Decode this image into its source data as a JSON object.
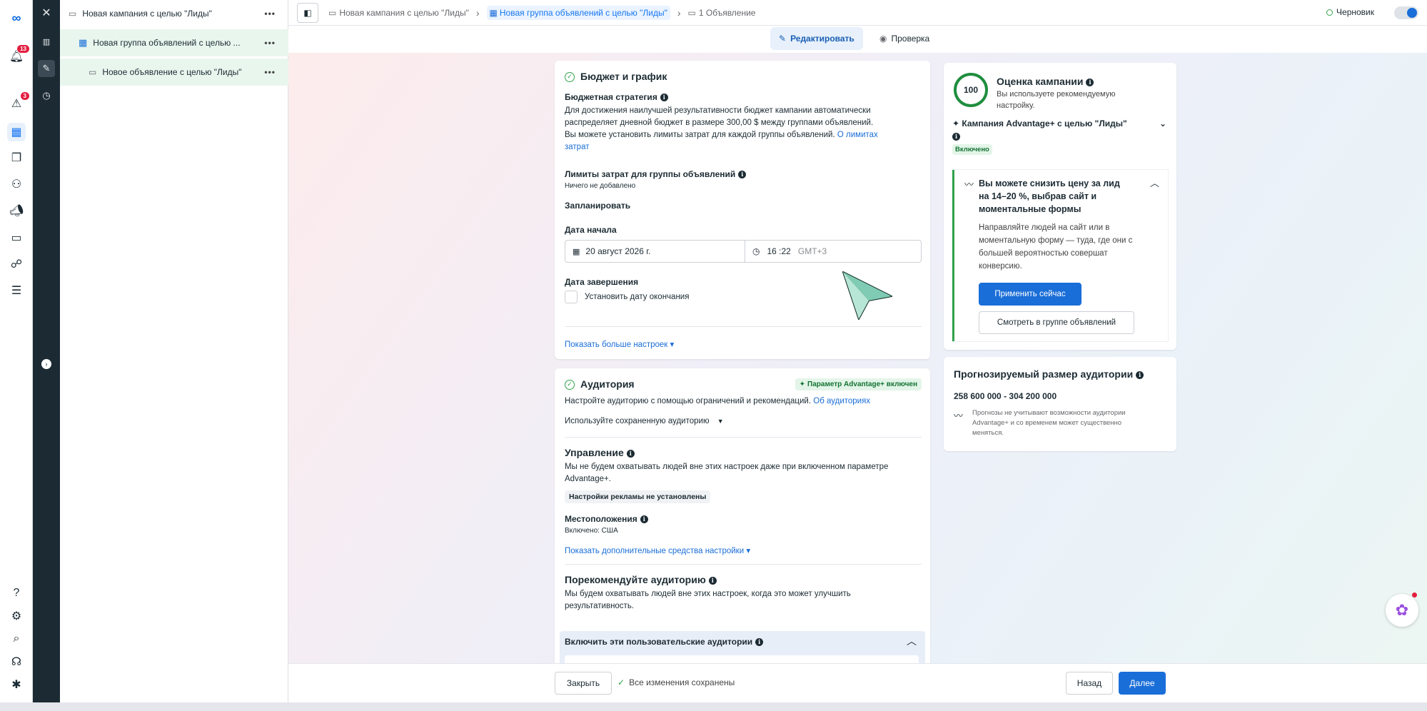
{
  "tree": {
    "campaign": "Новая кампания с целью \"Лиды\"",
    "adset": "Новая группа объявлений с целью ...",
    "ad": "Новое объявление с целью \"Лиды\""
  },
  "nav": {
    "notifications_badge": "13",
    "alerts_badge": "3"
  },
  "breadcrumb": {
    "campaign": "Новая кампания с целью \"Лиды\"",
    "adset": "Новая группа объявлений с целью \"Лиды\"",
    "ads": "1 Объявление"
  },
  "status": {
    "draft_label": "Черновик"
  },
  "tabs": {
    "edit": "Редактировать",
    "review": "Проверка"
  },
  "budget": {
    "title": "Бюджет и график",
    "strategy_label": "Бюджетная стратегия",
    "strategy_text_1": "Для достижения наилучшей результативности бюджет кампании автоматически",
    "strategy_text_2": "распределяет дневной бюджет в размере 300,00 $ между группами объявлений.",
    "strategy_text_3": "Вы можете установить лимиты затрат для каждой группы объявлений.",
    "strategy_link_1": "О лимитах",
    "strategy_link_2": "затрат",
    "limits_label": "Лимиты затрат для группы объявлений",
    "limits_value": "Ничего не добавлено",
    "schedule_label": "Запланировать",
    "start_label": "Дата начала",
    "start_date": "20 август 2026 г.",
    "start_time": "16 :22",
    "timezone": "GMT+3",
    "end_label": "Дата завершения",
    "end_checkbox": "Установить дату окончания",
    "more_settings": "Показать больше настроек ▾"
  },
  "audience": {
    "title": "Аудитория",
    "advantage_badge": "Параметр Advantage+ включен",
    "intro": "Настройте аудиторию с помощью ограничений и рекомендаций.",
    "intro_link": "Об аудиториях",
    "saved_dropdown": "Используйте сохраненную аудиторию",
    "control_title": "Управление",
    "control_text_1": "Мы не будем охватывать людей вне этих настроек даже при включенном параметре",
    "control_text_2": "Advantage+.",
    "no_settings_pill": "Настройки рекламы не установлены",
    "locations_label": "Местоположения",
    "locations_value": "Включено: США",
    "more_options": "Показать дополнительные средства настройки ▾",
    "suggest_title": "Порекомендуйте аудиторию",
    "suggest_text_1": "Мы будем охватывать людей вне этих настроек, когда это может улучшить",
    "suggest_text_2": "результативность.",
    "custom_label": "Включить эти пользовательские аудитории"
  },
  "score": {
    "value": "100",
    "progress": 1.0,
    "title": "Оценка кампании",
    "text_1": "Вы используете рекомендуемую",
    "text_2": "настройку.",
    "campaign_label": "Кампания Advantage+ с целью \"Лиды\"",
    "enabled": "Включено",
    "tip_title_1": "Вы можете снизить цену за лид",
    "tip_title_2": "на 14–20 %, выбрав сайт и",
    "tip_title_3": "моментальные формы",
    "tip_text_1": "Направляйте людей на сайт или в",
    "tip_text_2": "моментальную форму — туда, где они с",
    "tip_text_3": "большей вероятностью совершат",
    "tip_text_4": "конверсию.",
    "apply_btn": "Применить сейчас",
    "view_btn": "Смотреть в группе объявлений"
  },
  "size": {
    "title": "Прогнозируемый размер аудитории",
    "value": "258 600 000 - 304 200 000",
    "note_1": "Прогнозы не учитывают возможности аудитории",
    "note_2": "Advantage+ и со временем может существенно",
    "note_3": "меняться."
  },
  "footer": {
    "close": "Закрыть",
    "saved": "Все изменения сохранены",
    "back": "Назад",
    "next": "Далее"
  },
  "colors": {
    "accent": "#1a6ed8",
    "success": "#31a24c",
    "sidebar_dark": "#1c2b33"
  }
}
